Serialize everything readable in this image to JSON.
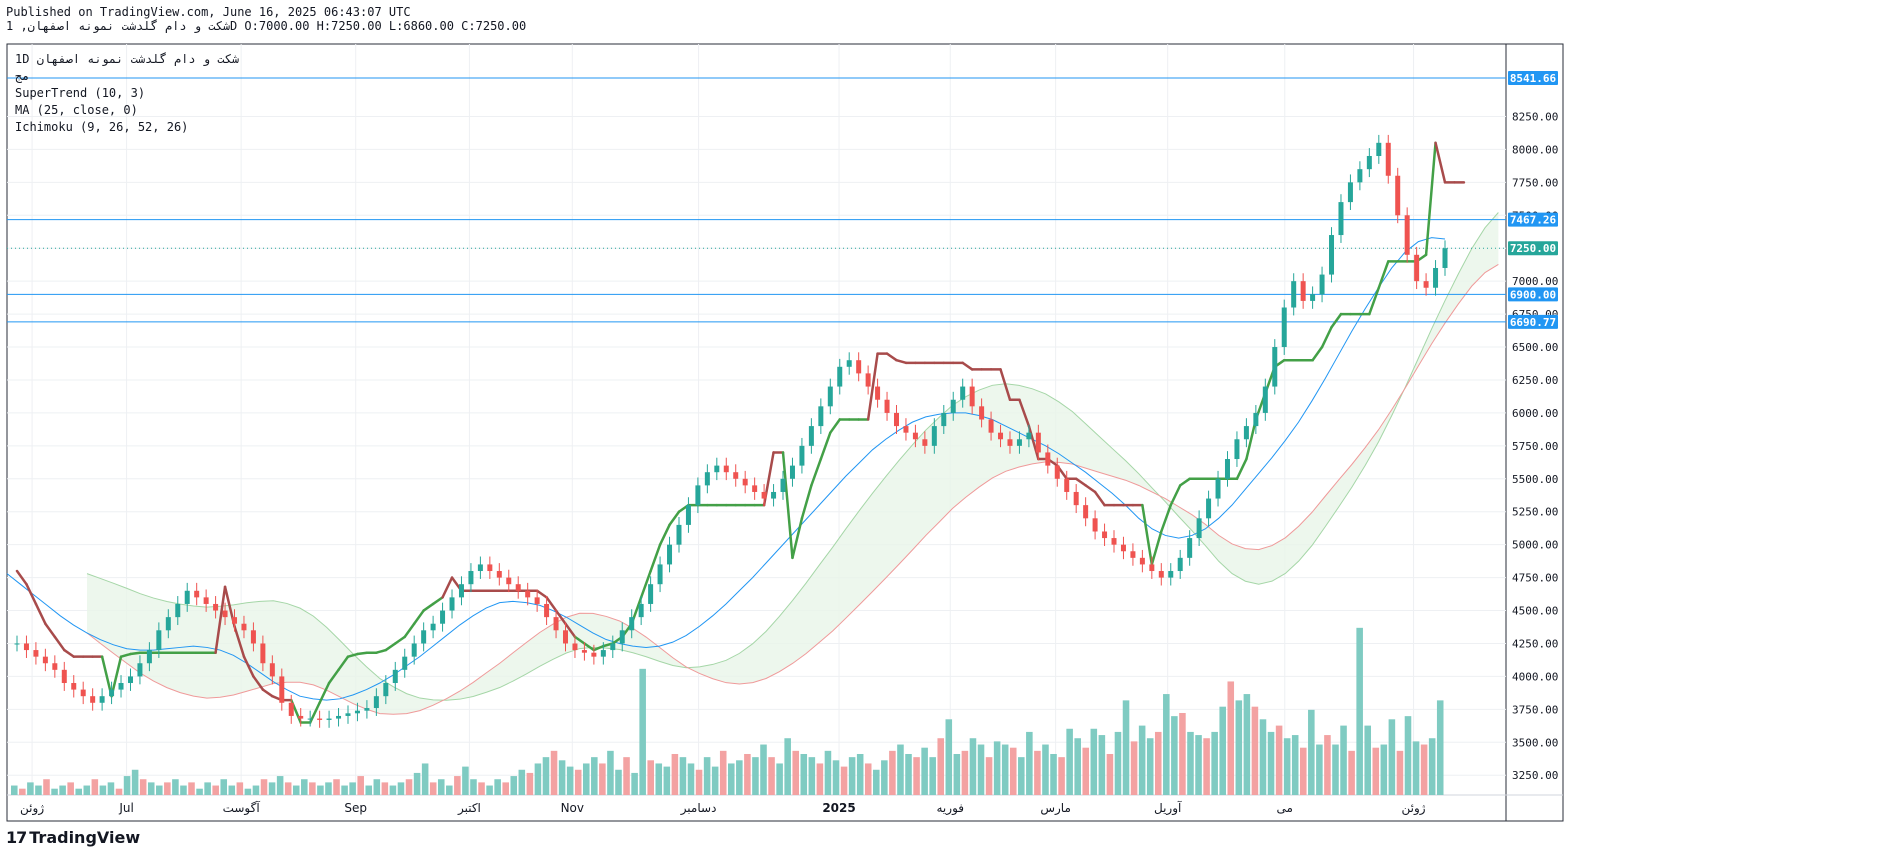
{
  "header": {
    "published": "Published on TradingView.com, June 16, 2025 06:43:07 UTC",
    "symbol_line": "شکت و دام گلدشت نمونه اصفهان, 1D O:7000.00 H:7250.00 L:6860.00 C:7250.00"
  },
  "legend": {
    "symbol": "شکت و دام گلدشت نمونه اصفهان",
    "interval": "1D",
    "sub": "مج",
    "indicators": [
      "SuperTrend (10, 3)",
      "MA (25, close, 0)",
      "Ichimoku (9, 26, 52, 26)"
    ]
  },
  "brand": {
    "logo": "17",
    "name": "TradingView"
  },
  "colors": {
    "up": "#26a69a",
    "down": "#ef5350",
    "st_up": "#43a047",
    "st_down": "#a84b4b",
    "ma": "#2196f3",
    "hline": "#2196f3",
    "grid": "#eef0f3"
  },
  "chart_data": {
    "type": "candlestick",
    "y_range": [
      3100,
      8800
    ],
    "y_ticks": [
      3250,
      3500,
      3750,
      4000,
      4250,
      4500,
      4750,
      5000,
      5250,
      5500,
      5750,
      6000,
      6250,
      6500,
      6750,
      7000,
      7250,
      7500,
      7750,
      8000,
      8250
    ],
    "x_labels": [
      "ژوئن",
      "Jul",
      "آگوست",
      "Sep",
      "اکتبر",
      "Nov",
      "دسامبر",
      "2025",
      "فوریه",
      "مارس",
      "آوریل",
      "می",
      "ژوئن"
    ],
    "horizontal_lines": [
      8541.66,
      7467.26,
      6900.0,
      6690.77
    ],
    "last_price": 7250.0,
    "ohlc_last": {
      "open": 7000.0,
      "high": 7250.0,
      "low": 6860.0,
      "close": 7250.0
    },
    "close_series": [
      4250,
      4200,
      4150,
      4100,
      4050,
      3950,
      3900,
      3850,
      3800,
      3850,
      3900,
      3950,
      4000,
      4100,
      4200,
      4350,
      4450,
      4550,
      4650,
      4600,
      4550,
      4500,
      4450,
      4400,
      4350,
      4250,
      4100,
      4000,
      3800,
      3700,
      3680,
      3680,
      3670,
      3680,
      3700,
      3720,
      3740,
      3760,
      3850,
      3950,
      4050,
      4150,
      4250,
      4350,
      4400,
      4500,
      4600,
      4700,
      4800,
      4850,
      4800,
      4750,
      4700,
      4650,
      4600,
      4550,
      4450,
      4350,
      4250,
      4200,
      4180,
      4150,
      4200,
      4250,
      4350,
      4450,
      4550,
      4700,
      4850,
      5000,
      5150,
      5300,
      5450,
      5550,
      5600,
      5550,
      5500,
      5450,
      5400,
      5350,
      5400,
      5500,
      5600,
      5750,
      5900,
      6050,
      6200,
      6350,
      6400,
      6300,
      6200,
      6100,
      6000,
      5900,
      5850,
      5800,
      5750,
      5900,
      6000,
      6100,
      6200,
      6050,
      5950,
      5850,
      5800,
      5750,
      5800,
      5850,
      5700,
      5600,
      5500,
      5400,
      5300,
      5200,
      5100,
      5050,
      5000,
      4950,
      4900,
      4850,
      4800,
      4750,
      4800,
      4900,
      5050,
      5200,
      5350,
      5500,
      5650,
      5800,
      5900,
      6000,
      6200,
      6500,
      6800,
      7000,
      6850,
      6900,
      7050,
      7350,
      7600,
      7750,
      7850,
      7950,
      8050,
      7800,
      7500,
      7200,
      7000,
      6950,
      7100,
      7250
    ],
    "supertrend": [
      4800,
      4700,
      4550,
      4400,
      4300,
      4200,
      4150,
      4150,
      4150,
      4150,
      3850,
      4150,
      4170,
      4180,
      4180,
      4180,
      4180,
      4180,
      4180,
      4180,
      4180,
      4180,
      4680,
      4380,
      4150,
      4000,
      3900,
      3850,
      3820,
      3820,
      3650,
      3650,
      3800,
      3950,
      4050,
      4150,
      4170,
      4180,
      4180,
      4200,
      4250,
      4300,
      4400,
      4500,
      4550,
      4600,
      4750,
      4650,
      4650,
      4650,
      4650,
      4650,
      4650,
      4650,
      4650,
      4650,
      4600,
      4500,
      4400,
      4300,
      4250,
      4200,
      4230,
      4250,
      4300,
      4400,
      4600,
      4800,
      5000,
      5150,
      5250,
      5300,
      5300,
      5300,
      5300,
      5300,
      5300,
      5300,
      5300,
      5300,
      5700,
      5700,
      4900,
      5200,
      5450,
      5650,
      5850,
      5950,
      5950,
      5950,
      5950,
      6450,
      6450,
      6400,
      6380,
      6380,
      6380,
      6380,
      6380,
      6380,
      6380,
      6330,
      6330,
      6330,
      6330,
      6100,
      6100,
      5900,
      5650,
      5650,
      5600,
      5500,
      5500,
      5450,
      5400,
      5300,
      5300,
      5300,
      5300,
      5300,
      4850,
      5100,
      5300,
      5450,
      5500,
      5500,
      5500,
      5500,
      5500,
      5500,
      5650,
      5950,
      6150,
      6350,
      6400,
      6400,
      6400,
      6400,
      6500,
      6650,
      6750,
      6750,
      6750,
      6750,
      6950,
      7150,
      7150,
      7150,
      7150,
      7200,
      8050,
      7750,
      7750,
      7750
    ],
    "supertrend_state": [
      "dn",
      "dn",
      "dn",
      "dn",
      "dn",
      "dn",
      "dn",
      "dn",
      "dn",
      "dn",
      "up",
      "up",
      "up",
      "up",
      "up",
      "up",
      "up",
      "up",
      "up",
      "up",
      "up",
      "up",
      "dn",
      "dn",
      "dn",
      "dn",
      "dn",
      "dn",
      "dn",
      "dn",
      "up",
      "up",
      "up",
      "up",
      "up",
      "up",
      "up",
      "up",
      "up",
      "up",
      "up",
      "up",
      "up",
      "up",
      "up",
      "up",
      "dn",
      "dn",
      "dn",
      "dn",
      "dn",
      "dn",
      "dn",
      "dn",
      "dn",
      "dn",
      "dn",
      "dn",
      "dn",
      "dn",
      "up",
      "up",
      "up",
      "up",
      "up",
      "up",
      "up",
      "up",
      "up",
      "up",
      "up",
      "up",
      "up",
      "up",
      "up",
      "up",
      "up",
      "up",
      "up",
      "up",
      "dn",
      "dn",
      "up",
      "up",
      "up",
      "up",
      "up",
      "up",
      "up",
      "up",
      "up",
      "dn",
      "dn",
      "dn",
      "dn",
      "dn",
      "dn",
      "dn",
      "dn",
      "dn",
      "dn",
      "dn",
      "dn",
      "dn",
      "dn",
      "dn",
      "dn",
      "dn",
      "dn",
      "dn",
      "dn",
      "dn",
      "dn",
      "dn",
      "dn",
      "dn",
      "dn",
      "dn",
      "dn",
      "dn",
      "up",
      "up",
      "up",
      "up",
      "up",
      "up",
      "up",
      "up",
      "up",
      "up",
      "up",
      "up",
      "up",
      "up",
      "up",
      "up",
      "up",
      "up",
      "up",
      "up",
      "up",
      "up",
      "up",
      "up",
      "up",
      "up",
      "up",
      "up",
      "up",
      "up",
      "up",
      "dn",
      "dn",
      "dn",
      "dn"
    ],
    "moving_average": [
      4780,
      4700,
      4620,
      4540,
      4460,
      4390,
      4330,
      4280,
      4240,
      4210,
      4200,
      4200,
      4210,
      4220,
      4230,
      4220,
      4200,
      4160,
      4100,
      4030,
      3960,
      3900,
      3850,
      3830,
      3820,
      3830,
      3860,
      3900,
      3950,
      4010,
      4080,
      4150,
      4230,
      4310,
      4390,
      4460,
      4520,
      4560,
      4570,
      4560,
      4540,
      4500,
      4450,
      4390,
      4330,
      4280,
      4250,
      4230,
      4220,
      4230,
      4260,
      4310,
      4380,
      4460,
      4550,
      4650,
      4750,
      4860,
      4970,
      5080,
      5190,
      5300,
      5410,
      5520,
      5620,
      5720,
      5800,
      5870,
      5930,
      5970,
      5990,
      6000,
      6000,
      5980,
      5950,
      5900,
      5850,
      5800,
      5750,
      5690,
      5620,
      5550,
      5470,
      5390,
      5300,
      5200,
      5120,
      5070,
      5050,
      5070,
      5120,
      5200,
      5300,
      5420,
      5540,
      5660,
      5790,
      5930,
      6090,
      6260,
      6440,
      6620,
      6790,
      6950,
      7100,
      7220,
      7300,
      7330,
      7320
    ],
    "volume_bars": [
      0.03,
      0.02,
      0.04,
      0.03,
      0.05,
      0.02,
      0.03,
      0.04,
      0.02,
      0.03,
      0.05,
      0.03,
      0.04,
      0.02,
      0.06,
      0.08,
      0.05,
      0.04,
      0.03,
      0.04,
      0.05,
      0.03,
      0.04,
      0.02,
      0.04,
      0.03,
      0.05,
      0.03,
      0.04,
      0.02,
      0.03,
      0.05,
      0.04,
      0.06,
      0.04,
      0.03,
      0.05,
      0.04,
      0.03,
      0.04,
      0.05,
      0.03,
      0.04,
      0.06,
      0.03,
      0.05,
      0.04,
      0.03,
      0.04,
      0.05,
      0.07,
      0.1,
      0.04,
      0.05,
      0.03,
      0.06,
      0.09,
      0.05,
      0.04,
      0.03,
      0.05,
      0.04,
      0.06,
      0.08,
      0.07,
      0.1,
      0.12,
      0.14,
      0.11,
      0.09,
      0.08,
      0.1,
      0.12,
      0.1,
      0.14,
      0.08,
      0.12,
      0.07,
      0.4,
      0.11,
      0.1,
      0.09,
      0.13,
      0.12,
      0.1,
      0.08,
      0.12,
      0.09,
      0.14,
      0.1,
      0.11,
      0.13,
      0.12,
      0.16,
      0.12,
      0.1,
      0.18,
      0.14,
      0.13,
      0.12,
      0.1,
      0.14,
      0.11,
      0.09,
      0.12,
      0.13,
      0.1,
      0.08,
      0.11,
      0.14,
      0.16,
      0.13,
      0.12,
      0.15,
      0.12,
      0.18,
      0.24,
      0.13,
      0.14,
      0.18,
      0.16,
      0.12,
      0.17,
      0.16,
      0.15,
      0.12,
      0.2,
      0.14,
      0.16,
      0.13,
      0.12,
      0.21,
      0.18,
      0.15,
      0.21,
      0.19,
      0.13,
      0.2,
      0.3,
      0.17,
      0.22,
      0.18,
      0.2,
      0.32,
      0.25,
      0.26,
      0.2,
      0.19,
      0.18,
      0.2,
      0.28,
      0.36,
      0.3,
      0.32,
      0.28,
      0.24,
      0.2,
      0.22,
      0.18,
      0.19,
      0.15,
      0.27,
      0.16,
      0.19,
      0.16,
      0.22,
      0.14,
      0.53,
      0.22,
      0.15,
      0.16,
      0.24,
      0.14,
      0.25,
      0.17,
      0.16,
      0.18,
      0.3
    ]
  }
}
